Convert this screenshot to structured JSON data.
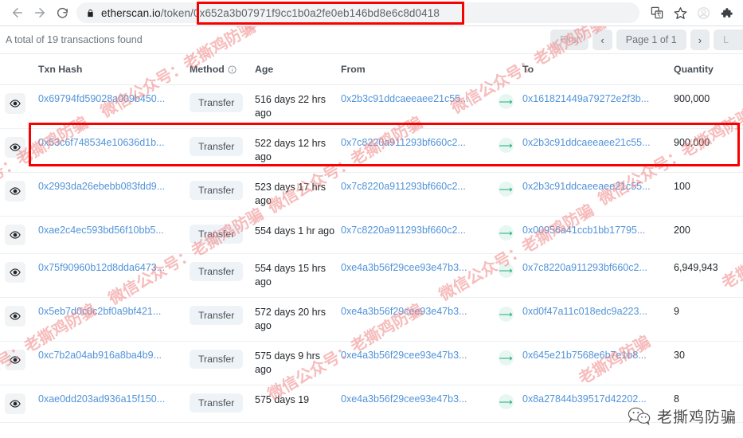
{
  "browser": {
    "back_icon": "arrow-left-icon",
    "forward_icon": "arrow-right-icon",
    "reload_icon": "reload-icon",
    "lock_icon": "lock-icon",
    "url_domain": "etherscan.io",
    "url_path": "/token/",
    "url_token": "0x652a3b07971f9cc1b0a2fe0eb146bd8e6c8d0418",
    "url_full": "etherscan.io/token/0x652a3b07971f9cc1b0a2fe0eb146bd8e6c8d0418",
    "translate_icon": "translate-icon",
    "bookmark_icon": "star-icon",
    "profile_icon": "profile-icon",
    "extensions_icon": "puzzle-icon"
  },
  "toolbar": {
    "total_text": "A total of 19 transactions found",
    "pager": {
      "first": "First",
      "prev": "‹",
      "page_label": "Page 1 of 1",
      "next": "›",
      "last": "L"
    }
  },
  "table": {
    "headers": {
      "eye": "",
      "hash": "Txn Hash",
      "method": "Method",
      "method_info_icon": "info-icon",
      "age": "Age",
      "from": "From",
      "arrow": "",
      "to": "To",
      "quantity": "Quantity"
    },
    "rows": [
      {
        "eye_icon": "eye-icon",
        "hash": "0x69794fd59028a009b450...",
        "method": "Transfer",
        "age": "516 days 22 hrs ago",
        "from": "0x2b3c91ddcaeeaee21c55...",
        "arrow_icon": "arrow-right-circle-icon",
        "to": "0x161821449a79272e2f3b...",
        "quantity": "900,000",
        "highlighted": true
      },
      {
        "eye_icon": "eye-icon",
        "hash": "0x53c6f748534e10636d1b...",
        "method": "Transfer",
        "age": "522 days 12 hrs ago",
        "from": "0x7c8220a911293bf660c2...",
        "arrow_icon": "arrow-right-circle-icon",
        "to": "0x2b3c91ddcaeeaee21c55...",
        "quantity": "900,000",
        "highlighted": false
      },
      {
        "eye_icon": "eye-icon",
        "hash": "0x2993da26ebebb083fdd9...",
        "method": "Transfer",
        "age": "523 days 17 hrs ago",
        "from": "0x7c8220a911293bf660c2...",
        "arrow_icon": "arrow-right-circle-icon",
        "to": "0x2b3c91ddcaeeaee21c55...",
        "quantity": "100",
        "highlighted": false
      },
      {
        "eye_icon": "eye-icon",
        "hash": "0xae2c4ec593bd56f10bb5...",
        "method": "Transfer",
        "age": "554 days 1 hr ago",
        "from": "0x7c8220a911293bf660c2...",
        "arrow_icon": "arrow-right-circle-icon",
        "to": "0x00956a41ccb1bb17795...",
        "quantity": "200",
        "highlighted": false
      },
      {
        "eye_icon": "eye-icon",
        "hash": "0x75f90960b12d8dda6473...",
        "method": "Transfer",
        "age": "554 days 15 hrs ago",
        "from": "0xe4a3b56f29cee93e47b3...",
        "arrow_icon": "arrow-right-circle-icon",
        "to": "0x7c8220a911293bf660c2...",
        "quantity": "6,949,943",
        "highlighted": false
      },
      {
        "eye_icon": "eye-icon",
        "hash": "0x5eb7d0c0c2bf0a9bf421...",
        "method": "Transfer",
        "age": "572 days 20 hrs ago",
        "from": "0xe4a3b56f29cee93e47b3...",
        "arrow_icon": "arrow-right-circle-icon",
        "to": "0xd0f47a11c018edc9a223...",
        "quantity": "9",
        "highlighted": false
      },
      {
        "eye_icon": "eye-icon",
        "hash": "0xc7b2a04ab916a8ba4b9...",
        "method": "Transfer",
        "age": "575 days 9 hrs ago",
        "from": "0xe4a3b56f29cee93e47b3...",
        "arrow_icon": "arrow-right-circle-icon",
        "to": "0x645e21b7568e6b7e1b8...",
        "quantity": "30",
        "highlighted": false
      },
      {
        "eye_icon": "eye-icon",
        "hash": "0xae0dd203ad936a15f150...",
        "method": "Transfer",
        "age": "575 days 19",
        "from": "0xe4a3b56f29cee93e47b3...",
        "arrow_icon": "arrow-right-circle-icon",
        "to": "0x8a27844b39517d42202...",
        "quantity": "8",
        "highlighted": false
      }
    ]
  },
  "watermark": {
    "text_a": "微信公众号：老撕鸡防骗",
    "text_b": "老撕鸡防骗",
    "logo_text": "老撕鸡防骗",
    "logo_icon": "wechat-icon",
    "color": "#f08080"
  },
  "annotations": {
    "url_box_color": "#f60000",
    "row_box_color": "#f60000"
  }
}
